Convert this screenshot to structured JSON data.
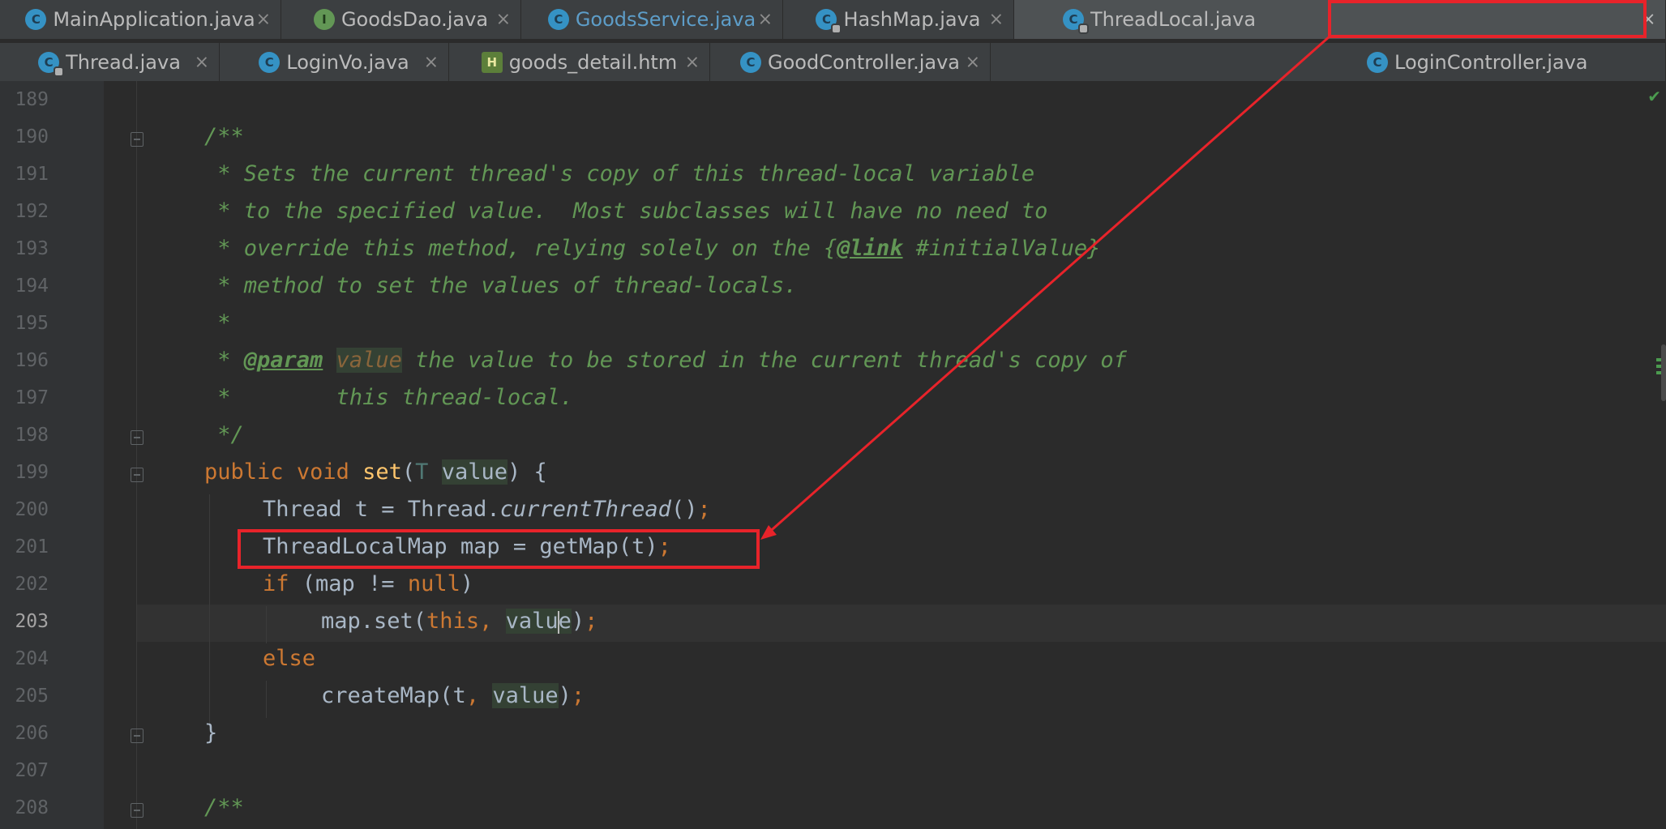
{
  "tabs_row1": [
    {
      "label": "MainApplication.java",
      "icon": "class-run-icon"
    },
    {
      "label": "GoodsDao.java",
      "icon": "interface-icon"
    },
    {
      "label": "GoodsService.java",
      "icon": "class-icon"
    },
    {
      "label": "HashMap.java",
      "icon": "class-locked-icon"
    },
    {
      "label": "ThreadLocal.java",
      "icon": "class-locked-icon"
    }
  ],
  "tabs_row2": [
    {
      "label": "Thread.java",
      "icon": "class-locked-icon"
    },
    {
      "label": "LoginVo.java",
      "icon": "class-icon"
    },
    {
      "label": "goods_detail.htm",
      "icon": "html-file-icon"
    },
    {
      "label": "GoodController.java",
      "icon": "class-icon"
    },
    {
      "label": "LoginController.java",
      "icon": "class-icon"
    }
  ],
  "close_glyph": "×",
  "editor": {
    "line_numbers": [
      "189",
      "190",
      "191",
      "192",
      "193",
      "194",
      "195",
      "196",
      "197",
      "198",
      "199",
      "200",
      "201",
      "202",
      "203",
      "204",
      "205",
      "206",
      "207",
      "208"
    ],
    "current_line": "203",
    "comment_open": "/**",
    "comment_lines": [
      " * Sets the current thread's copy of this thread-local variable",
      " * to the specified value.  Most subclasses will have no need to",
      " * override this method, relying solely on the {",
      " * method to set the values of thread-locals.",
      " *",
      " * ",
      " *        this thread-local."
    ],
    "link_tag": "@link",
    "link_rest": " #initialValue}",
    "param_tag": "@param",
    "param_name": "value",
    "param_rest": " the value to be stored in the current thread's copy of",
    "comment_close": " */",
    "kw_public": "public",
    "kw_void": "void",
    "method_set": "set",
    "type_t": "T",
    "param_value": "value",
    "line_200_a": "Thread t = Thread.",
    "line_200_call": "currentThread",
    "line_200_b": "()",
    "line_201": "ThreadLocalMap map = getMap(t)",
    "kw_if": "if",
    "line_202_a": " (map != ",
    "kw_null": "null",
    "line_202_b": ")",
    "line_203_a": "map.set(",
    "kw_this": "this",
    "line_203_val_a": "valu",
    "line_203_val_b": "e",
    "kw_else": "else",
    "line_205_a": "createMap(t",
    "brace_close": "}",
    "brace_open": " {",
    "semicolon": ";",
    "comma": ", "
  },
  "colors": {
    "highlight_box": "#e8232a",
    "keyword": "#cc7832",
    "comment": "#629755",
    "method": "#ffc66d"
  }
}
